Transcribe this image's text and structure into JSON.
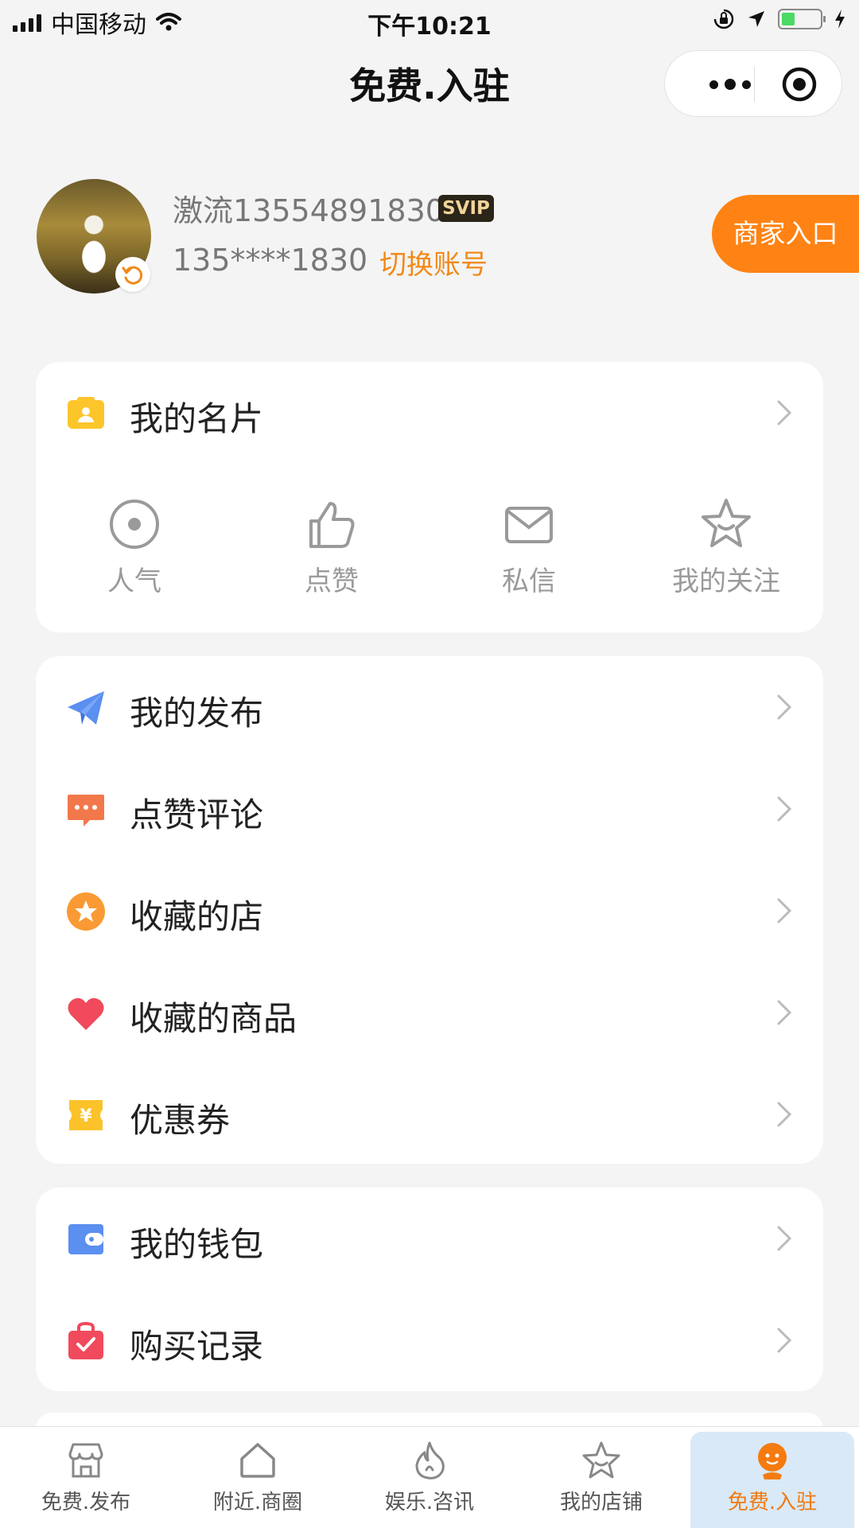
{
  "status_bar": {
    "carrier": "中国移动",
    "time": "下午10:21"
  },
  "nav": {
    "title": "免费.入驻"
  },
  "profile": {
    "username": "激流13554891830",
    "badge": "SVIP",
    "phone": "135****1830",
    "switch_account": "切换账号",
    "merchant_entry": "商家入口"
  },
  "card_section": {
    "title": "我的名片",
    "stats": [
      {
        "label": "人气",
        "icon": "popularity-icon"
      },
      {
        "label": "点赞",
        "icon": "thumbs-up-icon"
      },
      {
        "label": "私信",
        "icon": "envelope-icon"
      },
      {
        "label": "我的关注",
        "icon": "star-smile-icon"
      }
    ]
  },
  "menu_group1": [
    {
      "label": "我的发布",
      "icon": "paper-plane-icon"
    },
    {
      "label": "点赞评论",
      "icon": "chat-bubble-icon"
    },
    {
      "label": "收藏的店",
      "icon": "star-circle-icon"
    },
    {
      "label": "收藏的商品",
      "icon": "heart-icon"
    },
    {
      "label": "优惠券",
      "icon": "coupon-icon"
    }
  ],
  "menu_group2": [
    {
      "label": "我的钱包",
      "icon": "wallet-icon"
    },
    {
      "label": "购买记录",
      "icon": "shopping-bag-icon"
    }
  ],
  "tabbar": [
    {
      "label": "免费.发布",
      "icon": "store-icon"
    },
    {
      "label": "附近.商圈",
      "icon": "home-icon"
    },
    {
      "label": "娱乐.咨讯",
      "icon": "flame-icon"
    },
    {
      "label": "我的店铺",
      "icon": "star-icon"
    },
    {
      "label": "免费.入驻",
      "icon": "person-icon",
      "active": true
    }
  ],
  "colors": {
    "accent": "#ff8314",
    "link": "#f08a1a",
    "page_bg": "#f4f4f4",
    "active_tab_bg": "#d9e9f7"
  }
}
